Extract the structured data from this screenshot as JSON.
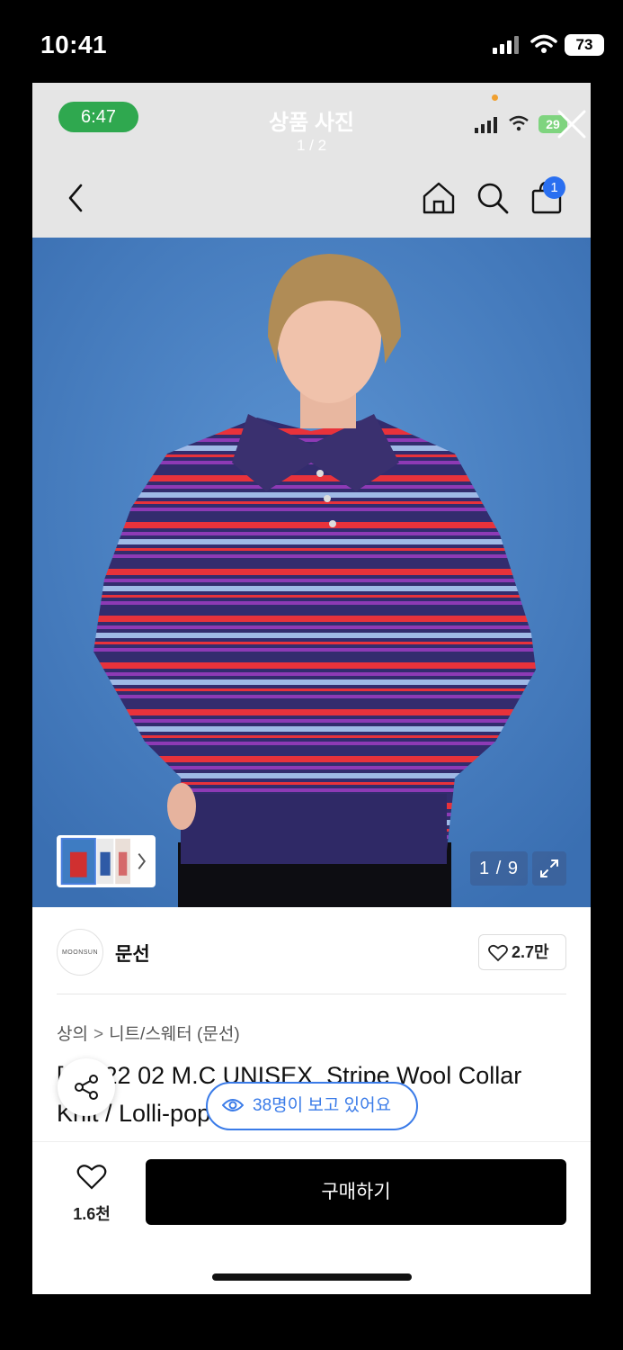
{
  "outer_status": {
    "time": "10:41",
    "battery": "73"
  },
  "inner_status": {
    "time": "6:47",
    "battery": "29"
  },
  "viewer": {
    "title": "상품 사진",
    "counter": "1 / 2"
  },
  "nav": {
    "cart_badge": "1",
    "icons": [
      "back-icon",
      "home-icon",
      "search-icon",
      "cart-icon"
    ]
  },
  "gallery": {
    "counter": "1 / 9",
    "expand_icon": "expand-icon"
  },
  "brand": {
    "logo_text": "MOONSUN",
    "name": "문선",
    "likes": "2.7만"
  },
  "breadcrumb": {
    "category": "상의",
    "separator": ">",
    "subcategory": "니트/스웨터 (문선)"
  },
  "product": {
    "title_line1": "[_ _]22 02 M.C UNISEX_Stripe Wool Collar",
    "title_line2": "Knit / Lolli-pop"
  },
  "viewers_pill": {
    "text": "38명이 보고 있어요"
  },
  "bottom": {
    "wish_count": "1.6천",
    "buy_label": "구매하기"
  },
  "colors": {
    "accent_blue": "#3a7be8",
    "buy_bg": "#000000",
    "status_green": "#2fa84f",
    "photo_bg": "#4a80c0"
  }
}
